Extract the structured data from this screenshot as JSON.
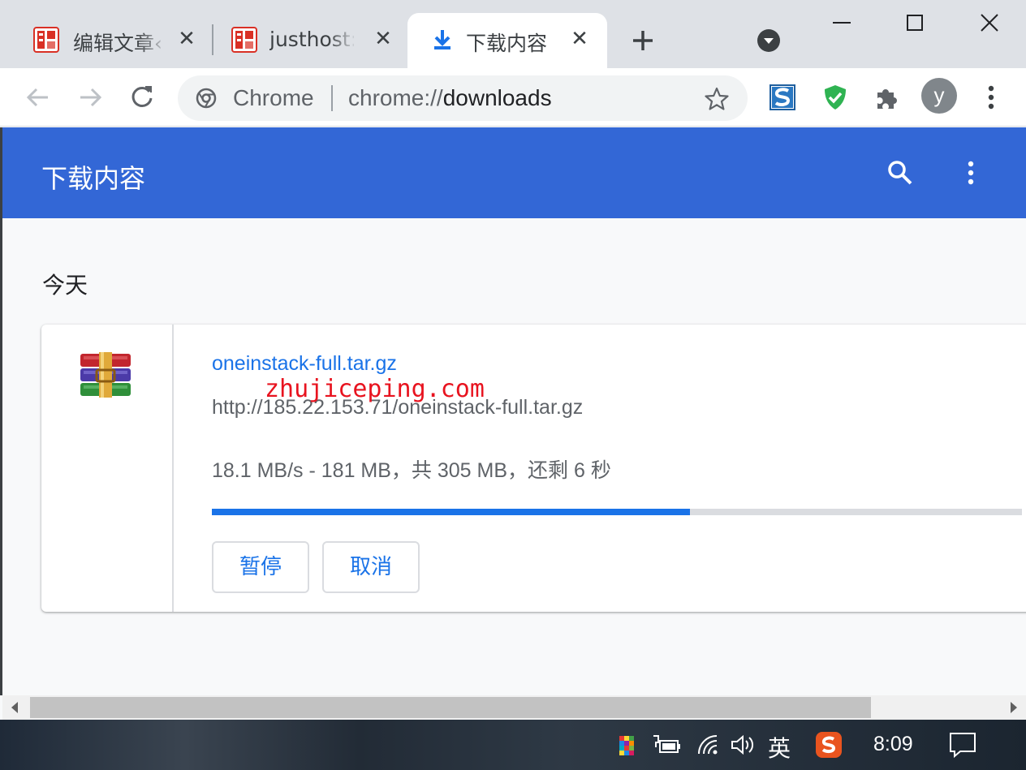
{
  "tabs": [
    {
      "title": "编辑文章‹",
      "active": false
    },
    {
      "title": "justhost:",
      "active": false
    },
    {
      "title": "下载内容",
      "active": true
    }
  ],
  "omnibox": {
    "scheme_label": "Chrome",
    "url_prefix": "chrome://",
    "url_host": "downloads"
  },
  "profile": {
    "initial": "y"
  },
  "header": {
    "title": "下载内容"
  },
  "downloads": {
    "date_heading": "今天",
    "items": [
      {
        "file_name": "oneinstack-full.tar.gz",
        "url": "http://185.22.153.71/oneinstack-full.tar.gz",
        "status": "18.1 MB/s - 181 MB，共 305 MB，还剩 6 秒",
        "progress_fraction": 0.59,
        "pause_label": "暂停",
        "cancel_label": "取消"
      }
    ]
  },
  "watermark": "zhujiceping.com",
  "taskbar": {
    "ime_label": "英",
    "clock": "8:09"
  },
  "colors": {
    "header_blue": "#3367d6",
    "link_blue": "#1a73e8",
    "watermark_red": "#e8131f"
  },
  "icons": [
    "wenzhang-favicon",
    "download-favicon",
    "plus-icon",
    "tab-search-icon",
    "minimize-icon",
    "maximize-icon",
    "close-icon",
    "back-arrow-icon",
    "forward-arrow-icon",
    "reload-icon",
    "chrome-logo-icon",
    "star-icon",
    "s-extension-icon",
    "shield-extension-icon",
    "puzzle-icon",
    "kebab-menu-icon",
    "search-icon",
    "winrar-archive-icon"
  ]
}
